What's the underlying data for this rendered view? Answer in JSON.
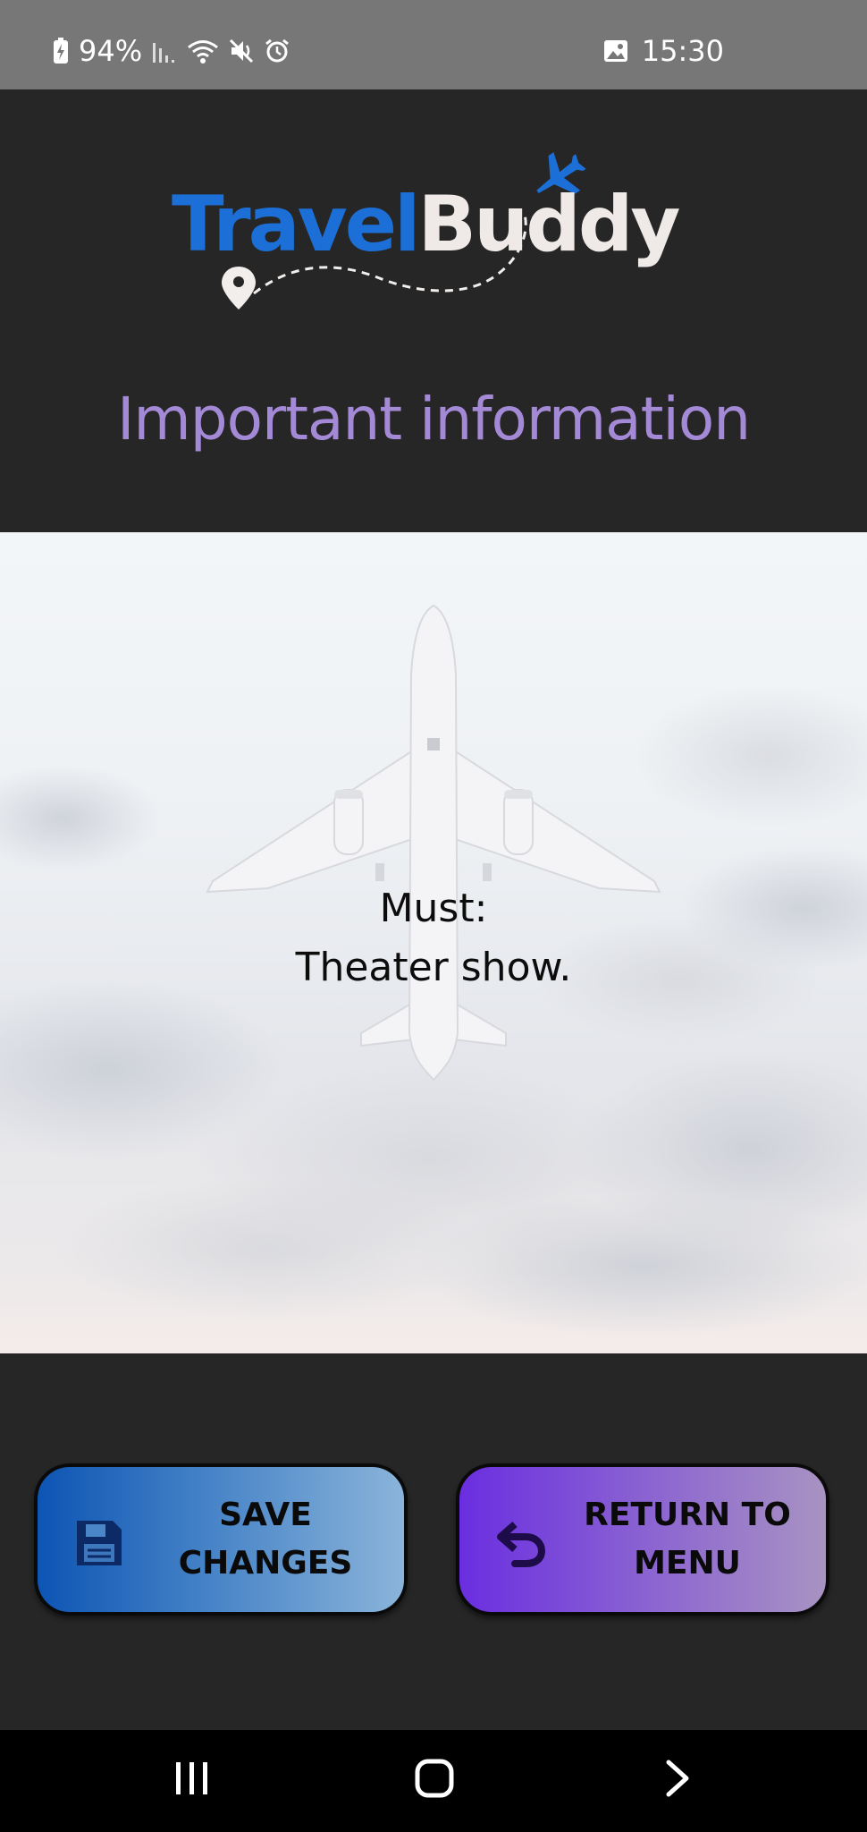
{
  "status_bar": {
    "battery": "94%",
    "time": "15:30"
  },
  "app": {
    "logo_part1": "Travel",
    "logo_part2": "Buddy",
    "page_title": "Important information"
  },
  "content": {
    "line1": "Must:",
    "line2": "Theater show."
  },
  "buttons": {
    "save_label": "SAVE\nCHANGES",
    "return_label": "RETURN TO\nMENU"
  },
  "colors": {
    "logo_blue": "#1c6fd6",
    "title_purple": "#a48ad6",
    "save_gradient_start": "#0d55b4",
    "return_gradient_start": "#6a2ee0"
  },
  "icons": {
    "save": "floppy-disk-icon",
    "return": "undo-arrow-icon",
    "nav_recents": "recents-icon",
    "nav_home": "home-icon",
    "nav_back": "back-chevron-icon"
  }
}
